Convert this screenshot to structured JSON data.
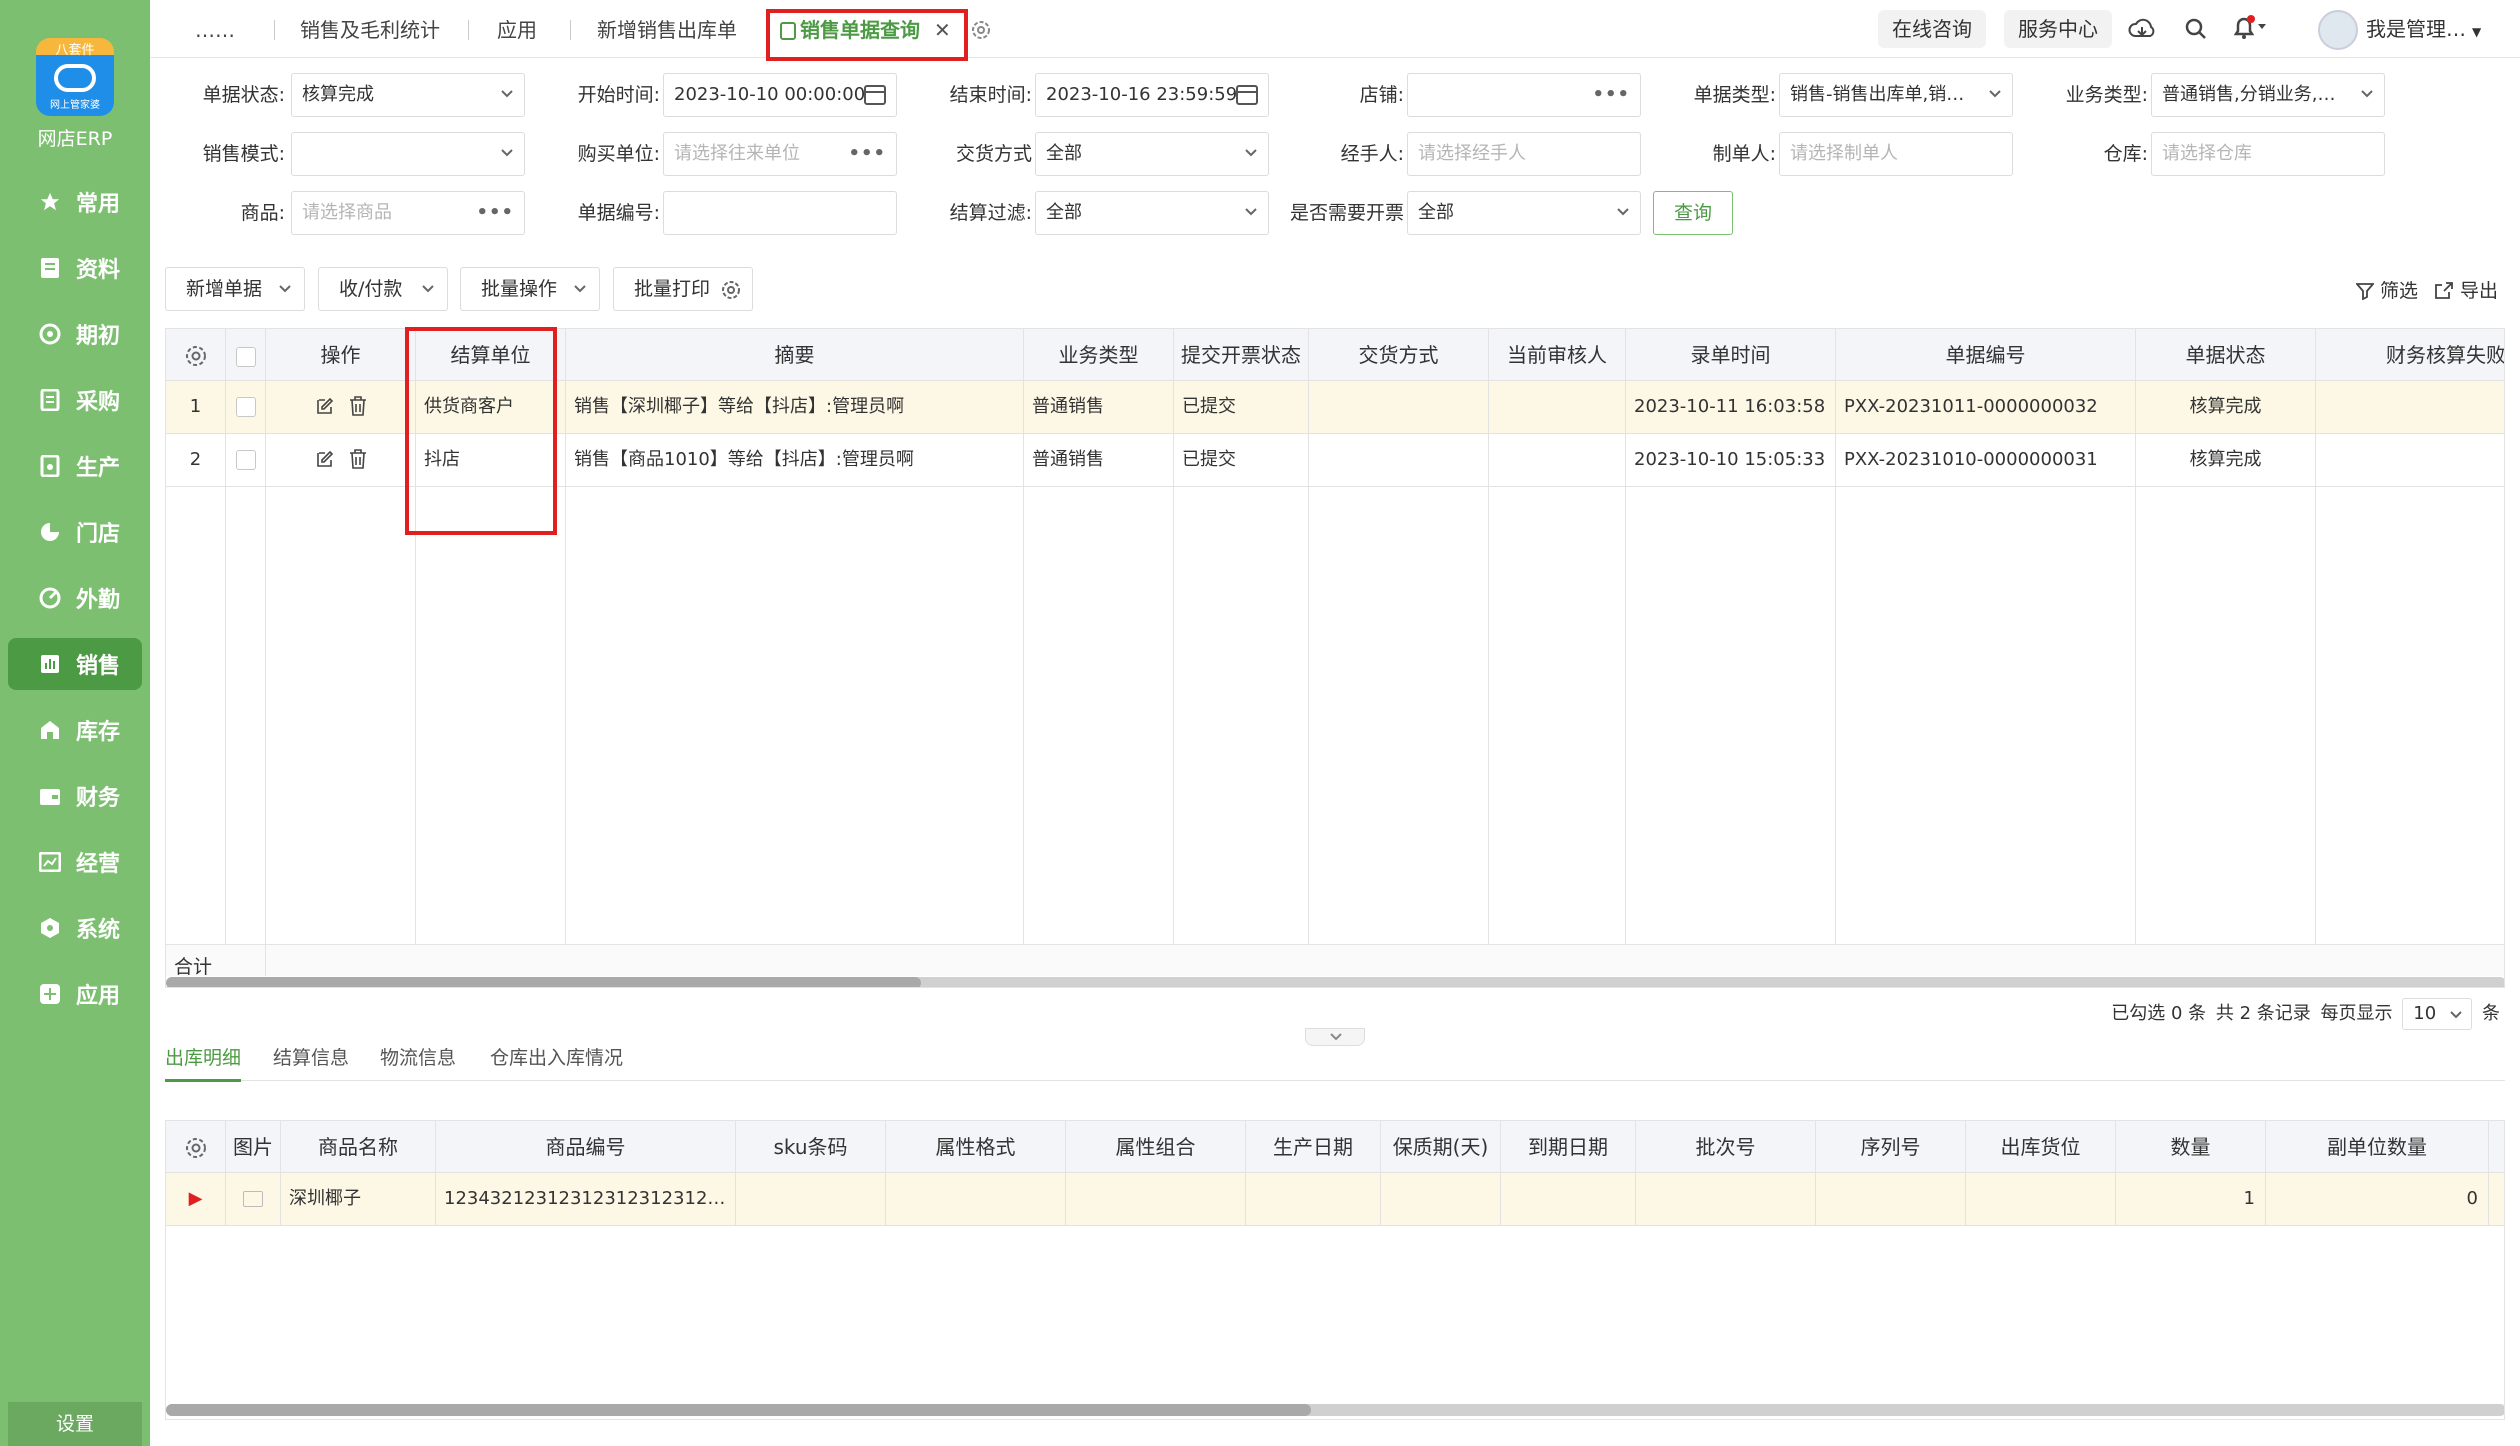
{
  "app": {
    "logo_top": "八套件",
    "logo_under": "网上管家婆",
    "logo_label": "网店ERP"
  },
  "sidebar": {
    "items": [
      {
        "label": "常用",
        "icon": "star-icon"
      },
      {
        "label": "资料",
        "icon": "document-icon"
      },
      {
        "label": "期初",
        "icon": "target-icon"
      },
      {
        "label": "采购",
        "icon": "list-icon"
      },
      {
        "label": "生产",
        "icon": "production-icon"
      },
      {
        "label": "门店",
        "icon": "store-icon"
      },
      {
        "label": "外勤",
        "icon": "field-icon"
      },
      {
        "label": "销售",
        "icon": "chart-icon",
        "active": true
      },
      {
        "label": "库存",
        "icon": "warehouse-icon"
      },
      {
        "label": "财务",
        "icon": "wallet-icon"
      },
      {
        "label": "经营",
        "icon": "operation-icon"
      },
      {
        "label": "系统",
        "icon": "system-icon"
      },
      {
        "label": "应用",
        "icon": "apps-icon"
      }
    ],
    "settings": "设置"
  },
  "tabs": {
    "more": "……",
    "items": [
      "销售及毛利统计",
      "应用",
      "新增销售出库单"
    ],
    "active": "销售单据查询"
  },
  "topbar": {
    "consult": "在线咨询",
    "service": "服务中心",
    "user": "我是管理…"
  },
  "filters": {
    "doc_status_label": "单据状态:",
    "doc_status_value": "核算完成",
    "start_label": "开始时间:",
    "start_value": "2023-10-10 00:00:00",
    "end_label": "结束时间:",
    "end_value": "2023-10-16 23:59:59",
    "shop_label": "店铺:",
    "doc_type_label": "单据类型:",
    "doc_type_value": "销售-销售出库单,销…",
    "biz_type_label": "业务类型:",
    "biz_type_value": "普通销售,分销业务,…",
    "sale_mode_label": "销售模式:",
    "buyer_label": "购买单位:",
    "buyer_placeholder": "请选择往来单位",
    "delivery_label": "交货方式",
    "delivery_value": "全部",
    "handler_label": "经手人:",
    "handler_placeholder": "请选择经手人",
    "maker_label": "制单人:",
    "maker_placeholder": "请选择制单人",
    "warehouse_label": "仓库:",
    "warehouse_placeholder": "请选择仓库",
    "goods_label": "商品:",
    "goods_placeholder": "请选择商品",
    "doc_no_label": "单据编号:",
    "settle_label": "结算过滤:",
    "settle_value": "全部",
    "invoice_label": "是否需要开票",
    "invoice_value": "全部",
    "query": "查询"
  },
  "toolbar": {
    "new_doc": "新增单据",
    "payment": "收/付款",
    "batch": "批量操作",
    "print": "批量打印",
    "filter": "筛选",
    "export": "导出"
  },
  "grid": {
    "headers": [
      "操作",
      "结算单位",
      "摘要",
      "业务类型",
      "提交开票状态",
      "交货方式",
      "当前审核人",
      "录单时间",
      "单据编号",
      "单据状态",
      "财务核算失败原因"
    ],
    "rows": [
      {
        "no": "1",
        "unit": "供货商客户",
        "summary": "销售【深圳椰子】等给【抖店】:管理员啊",
        "biz": "普通销售",
        "invoice": "已提交",
        "delivery": "",
        "auditor": "",
        "time": "2023-10-11 16:03:58",
        "doc_no": "PXX-20231011-0000000032",
        "status": "核算完成",
        "reason": ""
      },
      {
        "no": "2",
        "unit": "抖店",
        "summary": "销售【商品1010】等给【抖店】:管理员啊",
        "biz": "普通销售",
        "invoice": "已提交",
        "delivery": "",
        "auditor": "",
        "time": "2023-10-10 15:05:33",
        "doc_no": "PXX-20231010-0000000031",
        "status": "核算完成",
        "reason": ""
      }
    ],
    "total": "合计"
  },
  "pager": {
    "selected": "已勾选 0 条",
    "total": "共 2 条记录",
    "per_page_label": "每页显示",
    "per_page": "10",
    "unit": "条"
  },
  "subtabs": [
    "出库明细",
    "结算信息",
    "物流信息",
    "仓库出入库情况"
  ],
  "detail": {
    "headers": [
      "图片",
      "商品名称",
      "商品编号",
      "sku条码",
      "属性格式",
      "属性组合",
      "生产日期",
      "保质期(天)",
      "到期日期",
      "批次号",
      "序列号",
      "出库货位",
      "数量",
      "副单位数量"
    ],
    "rows": [
      {
        "name": "深圳椰子",
        "code": "12343212312312312312312…",
        "qty": "1",
        "sub_qty": "0"
      }
    ]
  },
  "colors": {
    "sidebar": "#7dbf71",
    "accent": "#4c9b44",
    "highlight": "#e02020"
  }
}
